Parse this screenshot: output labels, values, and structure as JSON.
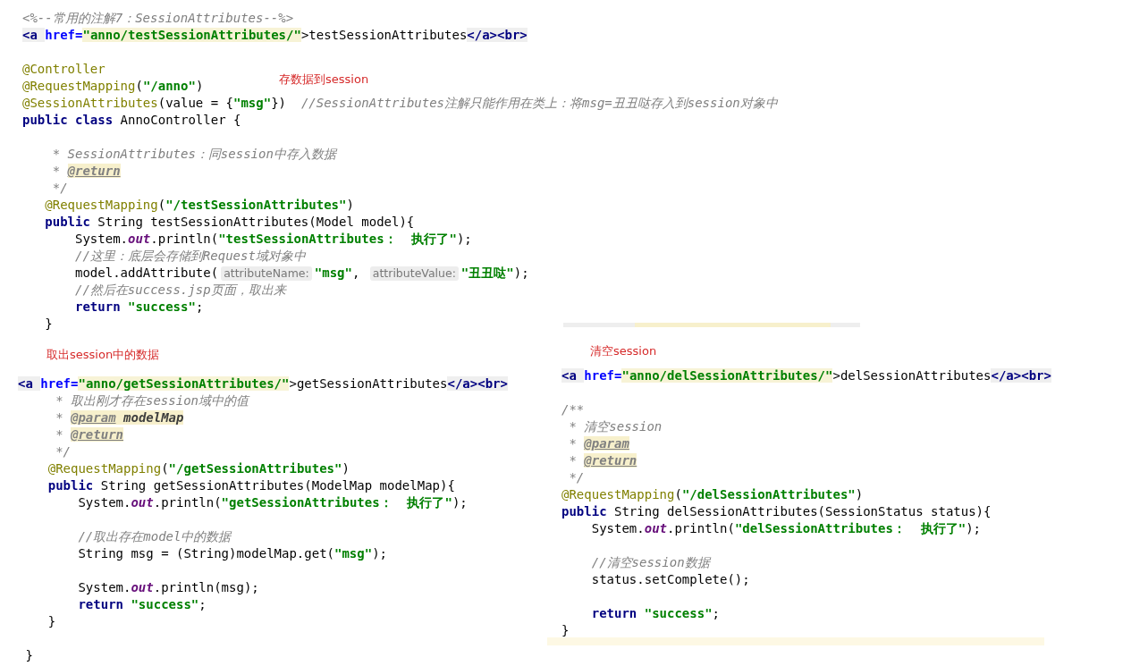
{
  "notes": [
    {
      "text": "存数据到session"
    },
    {
      "text": "取出session中的数据"
    },
    {
      "text": "清空session"
    }
  ],
  "snippets": [
    {
      "lines": [
        {
          "kind": "code",
          "tokens": [
            {
              "kind": "comment",
              "text": "<%--常用的注解7：SessionAttributes--%>"
            }
          ]
        },
        {
          "kind": "code",
          "tokens": [
            {
              "kind": "tag",
              "text": "<a "
            },
            {
              "kind": "attr",
              "text": "href="
            },
            {
              "kind": "attrval",
              "text": "\"anno/testSessionAttributes/\""
            },
            {
              "kind": "plain",
              "text": ">testSessionAttributes"
            },
            {
              "kind": "tag",
              "text": "</a><br>"
            }
          ]
        },
        {
          "kind": "blank"
        },
        {
          "kind": "code",
          "tokens": [
            {
              "kind": "ann",
              "text": "@Controller"
            }
          ]
        },
        {
          "kind": "code",
          "tokens": [
            {
              "kind": "ann",
              "text": "@RequestMapping"
            },
            {
              "kind": "plain",
              "text": "("
            },
            {
              "kind": "str",
              "text": "\"/anno\""
            },
            {
              "kind": "plain",
              "text": ")"
            }
          ]
        },
        {
          "kind": "code",
          "tokens": [
            {
              "kind": "ann",
              "text": "@SessionAttributes"
            },
            {
              "kind": "plain",
              "text": "(value = {"
            },
            {
              "kind": "str",
              "text": "\"msg\""
            },
            {
              "kind": "plain",
              "text": "})  "
            },
            {
              "kind": "comment",
              "text": "//SessionAttributes注解只能作用在类上：将msg=丑丑哒存入到session对象中"
            }
          ]
        },
        {
          "kind": "code",
          "tokens": [
            {
              "kind": "kw",
              "text": "public class "
            },
            {
              "kind": "plain",
              "text": "AnnoController {"
            }
          ]
        },
        {
          "kind": "blank"
        },
        {
          "kind": "code",
          "tokens": [
            {
              "kind": "comment",
              "text": "    * SessionAttributes：同session中存入数据"
            }
          ]
        },
        {
          "kind": "code",
          "tokens": [
            {
              "kind": "comment",
              "text": "    * "
            },
            {
              "kind": "doctag",
              "text": "@return"
            }
          ]
        },
        {
          "kind": "code",
          "tokens": [
            {
              "kind": "comment",
              "text": "    */"
            }
          ]
        },
        {
          "kind": "code",
          "tokens": [
            {
              "kind": "ann",
              "text": "   @RequestMapping"
            },
            {
              "kind": "plain",
              "text": "("
            },
            {
              "kind": "str",
              "text": "\"/testSessionAttributes\""
            },
            {
              "kind": "plain",
              "text": ")"
            }
          ]
        },
        {
          "kind": "code",
          "tokens": [
            {
              "kind": "kw",
              "text": "   public "
            },
            {
              "kind": "plain",
              "text": "String testSessionAttributes(Model model){"
            }
          ]
        },
        {
          "kind": "code",
          "tokens": [
            {
              "kind": "plain",
              "text": "       System."
            },
            {
              "kind": "field",
              "text": "out"
            },
            {
              "kind": "plain",
              "text": ".println("
            },
            {
              "kind": "str",
              "text": "\"testSessionAttributes：  执行了\""
            },
            {
              "kind": "plain",
              "text": ");"
            }
          ]
        },
        {
          "kind": "code",
          "tokens": [
            {
              "kind": "comment",
              "text": "       //这里：底层会存储到Request域对象中"
            }
          ]
        },
        {
          "kind": "code",
          "tokens": [
            {
              "kind": "plain",
              "text": "       model.addAttribute("
            },
            {
              "kind": "hint",
              "text": "attributeName:"
            },
            {
              "kind": "str",
              "text": "\"msg\""
            },
            {
              "kind": "plain",
              "text": ", "
            },
            {
              "kind": "hint",
              "text": "attributeValue:"
            },
            {
              "kind": "str",
              "text": "\"丑丑哒\""
            },
            {
              "kind": "plain",
              "text": ");"
            }
          ]
        },
        {
          "kind": "code",
          "tokens": [
            {
              "kind": "comment",
              "text": "       //然后在success.jsp页面，取出来"
            }
          ]
        },
        {
          "kind": "code",
          "tokens": [
            {
              "kind": "kw",
              "text": "       return "
            },
            {
              "kind": "str",
              "text": "\"success\""
            },
            {
              "kind": "plain",
              "text": ";"
            }
          ]
        },
        {
          "kind": "code",
          "tokens": [
            {
              "kind": "plain",
              "text": "   }"
            }
          ]
        }
      ]
    },
    {
      "lines": [
        {
          "kind": "code",
          "tokens": [
            {
              "kind": "tag",
              "text": "<a "
            },
            {
              "kind": "attr",
              "text": "href="
            },
            {
              "kind": "attrval",
              "text": "\"anno/getSessionAttributes/\""
            },
            {
              "kind": "plain",
              "text": ">getSessionAttributes"
            },
            {
              "kind": "tag",
              "text": "</a><br>"
            }
          ]
        },
        {
          "kind": "code",
          "tokens": [
            {
              "kind": "comment",
              "text": "     * 取出刚才存在session域中的值"
            }
          ]
        },
        {
          "kind": "code",
          "tokens": [
            {
              "kind": "comment",
              "text": "     * "
            },
            {
              "kind": "doctag",
              "text": "@param"
            },
            {
              "kind": "docparam",
              "text": " modelMap"
            }
          ]
        },
        {
          "kind": "code",
          "tokens": [
            {
              "kind": "comment",
              "text": "     * "
            },
            {
              "kind": "doctag",
              "text": "@return"
            }
          ]
        },
        {
          "kind": "code",
          "tokens": [
            {
              "kind": "comment",
              "text": "     */"
            }
          ]
        },
        {
          "kind": "code",
          "tokens": [
            {
              "kind": "ann",
              "text": "    @RequestMapping"
            },
            {
              "kind": "plain",
              "text": "("
            },
            {
              "kind": "str",
              "text": "\"/getSessionAttributes\""
            },
            {
              "kind": "plain",
              "text": ")"
            }
          ]
        },
        {
          "kind": "code",
          "tokens": [
            {
              "kind": "kw",
              "text": "    public "
            },
            {
              "kind": "plain",
              "text": "String getSessionAttributes(ModelMap modelMap){"
            }
          ]
        },
        {
          "kind": "code",
          "tokens": [
            {
              "kind": "plain",
              "text": "        System."
            },
            {
              "kind": "field",
              "text": "out"
            },
            {
              "kind": "plain",
              "text": ".println("
            },
            {
              "kind": "str",
              "text": "\"getSessionAttributes：  执行了\""
            },
            {
              "kind": "plain",
              "text": ");"
            }
          ]
        },
        {
          "kind": "blank"
        },
        {
          "kind": "code",
          "tokens": [
            {
              "kind": "comment",
              "text": "        //取出存在model中的数据"
            }
          ]
        },
        {
          "kind": "code",
          "tokens": [
            {
              "kind": "plain",
              "text": "        String msg = (String)modelMap.get("
            },
            {
              "kind": "str",
              "text": "\"msg\""
            },
            {
              "kind": "plain",
              "text": ");"
            }
          ]
        },
        {
          "kind": "blank"
        },
        {
          "kind": "code",
          "tokens": [
            {
              "kind": "plain",
              "text": "        System."
            },
            {
              "kind": "field",
              "text": "out"
            },
            {
              "kind": "plain",
              "text": ".println(msg);"
            }
          ]
        },
        {
          "kind": "code",
          "tokens": [
            {
              "kind": "kw",
              "text": "        return "
            },
            {
              "kind": "str",
              "text": "\"success\""
            },
            {
              "kind": "plain",
              "text": ";"
            }
          ]
        },
        {
          "kind": "code",
          "tokens": [
            {
              "kind": "plain",
              "text": "    }"
            }
          ]
        },
        {
          "kind": "blank"
        },
        {
          "kind": "code",
          "tokens": [
            {
              "kind": "plain",
              "text": " }"
            }
          ]
        }
      ]
    },
    {
      "lines": [
        {
          "kind": "code",
          "tokens": [
            {
              "kind": "tag",
              "text": "<a "
            },
            {
              "kind": "attr",
              "text": "href="
            },
            {
              "kind": "attrval",
              "text": "\"anno/delSessionAttributes/\""
            },
            {
              "kind": "plain",
              "text": ">delSessionAttributes"
            },
            {
              "kind": "tag",
              "text": "</a><br>"
            }
          ]
        },
        {
          "kind": "blank"
        },
        {
          "kind": "code",
          "tokens": [
            {
              "kind": "comment",
              "text": "/**"
            }
          ]
        },
        {
          "kind": "code",
          "tokens": [
            {
              "kind": "comment",
              "text": " * 清空session"
            }
          ]
        },
        {
          "kind": "code",
          "tokens": [
            {
              "kind": "comment",
              "text": " * "
            },
            {
              "kind": "doctag",
              "text": "@param"
            }
          ]
        },
        {
          "kind": "code",
          "tokens": [
            {
              "kind": "comment",
              "text": " * "
            },
            {
              "kind": "doctag",
              "text": "@return"
            }
          ]
        },
        {
          "kind": "code",
          "tokens": [
            {
              "kind": "comment",
              "text": " */"
            }
          ]
        },
        {
          "kind": "code",
          "tokens": [
            {
              "kind": "ann",
              "text": "@RequestMapping"
            },
            {
              "kind": "plain",
              "text": "("
            },
            {
              "kind": "str",
              "text": "\"/delSessionAttributes\""
            },
            {
              "kind": "plain",
              "text": ")"
            }
          ]
        },
        {
          "kind": "code",
          "tokens": [
            {
              "kind": "kw",
              "text": "public "
            },
            {
              "kind": "plain",
              "text": "String delSessionAttributes(SessionStatus status){"
            }
          ]
        },
        {
          "kind": "code",
          "tokens": [
            {
              "kind": "plain",
              "text": "    System."
            },
            {
              "kind": "field",
              "text": "out"
            },
            {
              "kind": "plain",
              "text": ".println("
            },
            {
              "kind": "str",
              "text": "\"delSessionAttributes：  执行了\""
            },
            {
              "kind": "plain",
              "text": ");"
            }
          ]
        },
        {
          "kind": "blank"
        },
        {
          "kind": "code",
          "tokens": [
            {
              "kind": "comment",
              "text": "    //清空session数据"
            }
          ]
        },
        {
          "kind": "code",
          "tokens": [
            {
              "kind": "plain",
              "text": "    status.setComplete();"
            }
          ]
        },
        {
          "kind": "blank"
        },
        {
          "kind": "code",
          "tokens": [
            {
              "kind": "kw",
              "text": "    return "
            },
            {
              "kind": "str",
              "text": "\"success\""
            },
            {
              "kind": "plain",
              "text": ";"
            }
          ]
        },
        {
          "kind": "code",
          "tokens": [
            {
              "kind": "plain",
              "text": "}"
            }
          ]
        }
      ]
    }
  ]
}
